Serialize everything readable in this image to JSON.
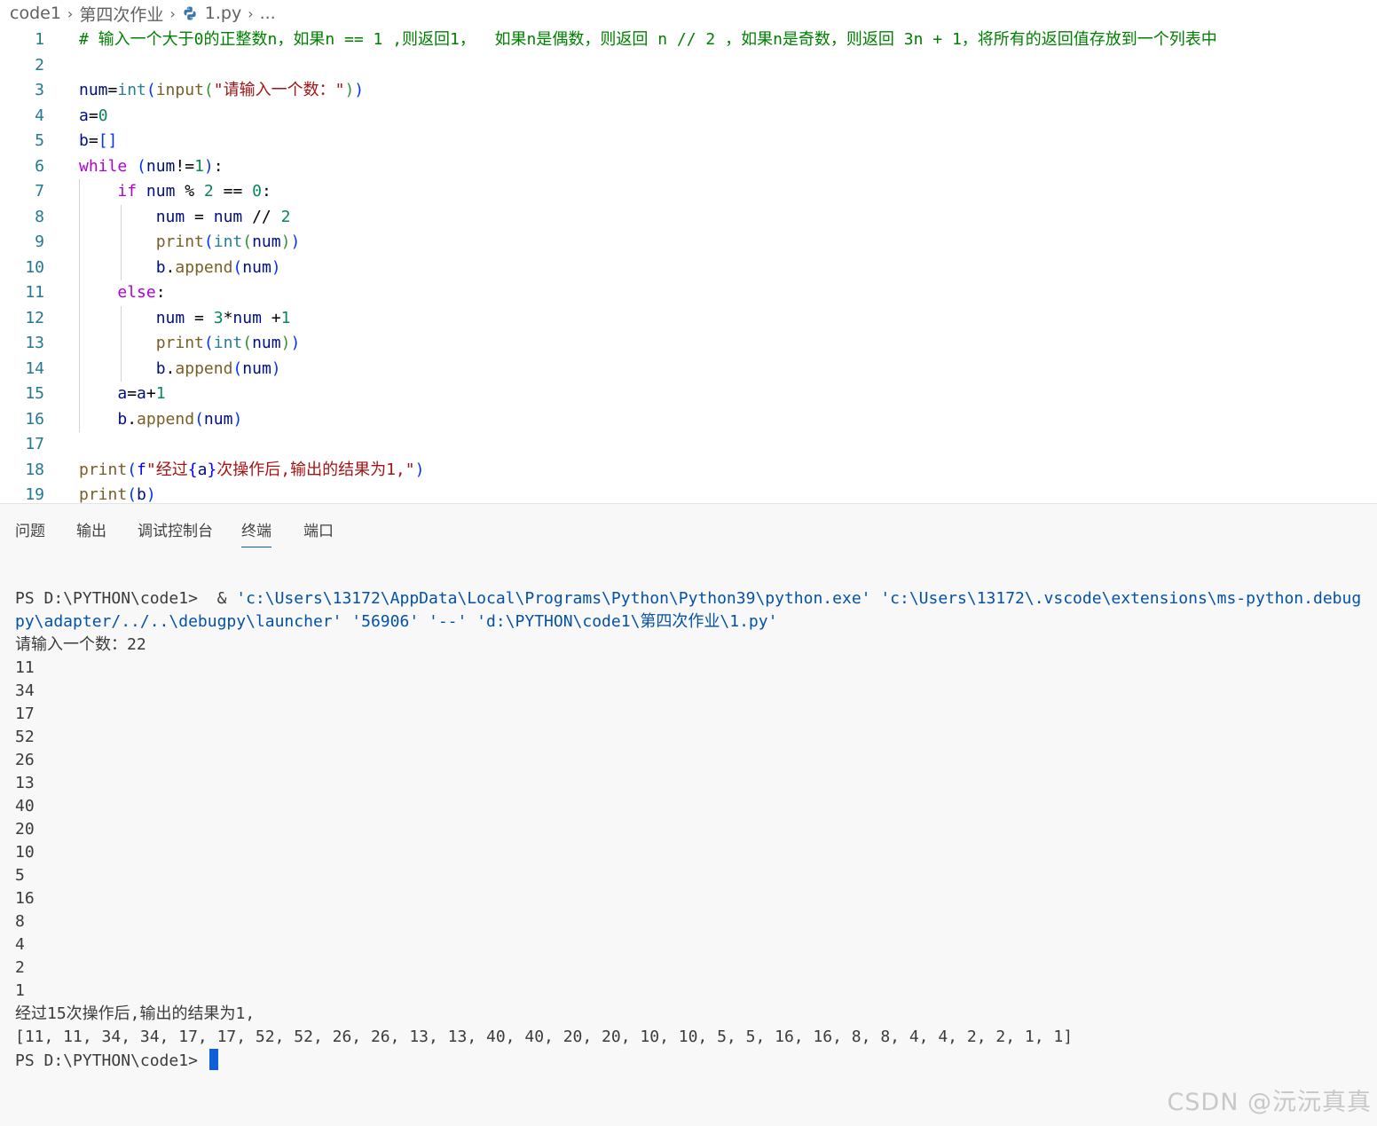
{
  "breadcrumb": {
    "items": [
      "code1",
      "第四次作业",
      "1.py",
      "..."
    ]
  },
  "editor": {
    "line_numbers": [
      "1",
      "2",
      "3",
      "4",
      "5",
      "6",
      "7",
      "8",
      "9",
      "10",
      "11",
      "12",
      "13",
      "14",
      "15",
      "16",
      "17",
      "18",
      "19"
    ],
    "lines": [
      [
        {
          "t": "# 输入一个大于0的正整数n，如果n == 1 ,则返回1，  如果n是偶数，则返回 n // 2 ，如果n是奇数，则返回 3n + 1，将所有的返回值存放到一个列表中",
          "c": "c-com"
        }
      ],
      [],
      [
        {
          "t": "num",
          "c": "c-var"
        },
        {
          "t": "=",
          "c": "c-op"
        },
        {
          "t": "int",
          "c": "c-bi"
        },
        {
          "t": "(",
          "c": "c-br1"
        },
        {
          "t": "input",
          "c": "c-fn"
        },
        {
          "t": "(",
          "c": "c-br2"
        },
        {
          "t": "\"请输入一个数：\"",
          "c": "c-str"
        },
        {
          "t": ")",
          "c": "c-br2"
        },
        {
          "t": ")",
          "c": "c-br1"
        }
      ],
      [
        {
          "t": "a",
          "c": "c-var"
        },
        {
          "t": "=",
          "c": "c-op"
        },
        {
          "t": "0",
          "c": "c-num"
        }
      ],
      [
        {
          "t": "b",
          "c": "c-var"
        },
        {
          "t": "=",
          "c": "c-op"
        },
        {
          "t": "[]",
          "c": "c-br1"
        }
      ],
      [
        {
          "t": "while",
          "c": "c-kw"
        },
        {
          "t": " ",
          "c": "c-op"
        },
        {
          "t": "(",
          "c": "c-br1"
        },
        {
          "t": "num",
          "c": "c-var"
        },
        {
          "t": "!=",
          "c": "c-op"
        },
        {
          "t": "1",
          "c": "c-num"
        },
        {
          "t": ")",
          "c": "c-br1"
        },
        {
          "t": ":",
          "c": "c-op"
        }
      ],
      [
        {
          "t": "    ",
          "c": "c-op"
        },
        {
          "t": "if",
          "c": "c-kw"
        },
        {
          "t": " ",
          "c": "c-op"
        },
        {
          "t": "num",
          "c": "c-var"
        },
        {
          "t": " % ",
          "c": "c-op"
        },
        {
          "t": "2",
          "c": "c-num"
        },
        {
          "t": " == ",
          "c": "c-op"
        },
        {
          "t": "0",
          "c": "c-num"
        },
        {
          "t": ":",
          "c": "c-op"
        }
      ],
      [
        {
          "t": "        ",
          "c": "c-op"
        },
        {
          "t": "num",
          "c": "c-var"
        },
        {
          "t": " = ",
          "c": "c-op"
        },
        {
          "t": "num",
          "c": "c-var"
        },
        {
          "t": " // ",
          "c": "c-op"
        },
        {
          "t": "2",
          "c": "c-num"
        }
      ],
      [
        {
          "t": "        ",
          "c": "c-op"
        },
        {
          "t": "print",
          "c": "c-fn"
        },
        {
          "t": "(",
          "c": "c-br1"
        },
        {
          "t": "int",
          "c": "c-bi"
        },
        {
          "t": "(",
          "c": "c-br2"
        },
        {
          "t": "num",
          "c": "c-var"
        },
        {
          "t": ")",
          "c": "c-br2"
        },
        {
          "t": ")",
          "c": "c-br1"
        }
      ],
      [
        {
          "t": "        ",
          "c": "c-op"
        },
        {
          "t": "b",
          "c": "c-var"
        },
        {
          "t": ".",
          "c": "c-op"
        },
        {
          "t": "append",
          "c": "c-fn"
        },
        {
          "t": "(",
          "c": "c-br1"
        },
        {
          "t": "num",
          "c": "c-var"
        },
        {
          "t": ")",
          "c": "c-br1"
        }
      ],
      [
        {
          "t": "    ",
          "c": "c-op"
        },
        {
          "t": "else",
          "c": "c-kw"
        },
        {
          "t": ":",
          "c": "c-op"
        }
      ],
      [
        {
          "t": "        ",
          "c": "c-op"
        },
        {
          "t": "num",
          "c": "c-var"
        },
        {
          "t": " = ",
          "c": "c-op"
        },
        {
          "t": "3",
          "c": "c-num"
        },
        {
          "t": "*",
          "c": "c-op"
        },
        {
          "t": "num",
          "c": "c-var"
        },
        {
          "t": " +",
          "c": "c-op"
        },
        {
          "t": "1",
          "c": "c-num"
        }
      ],
      [
        {
          "t": "        ",
          "c": "c-op"
        },
        {
          "t": "print",
          "c": "c-fn"
        },
        {
          "t": "(",
          "c": "c-br1"
        },
        {
          "t": "int",
          "c": "c-bi"
        },
        {
          "t": "(",
          "c": "c-br2"
        },
        {
          "t": "num",
          "c": "c-var"
        },
        {
          "t": ")",
          "c": "c-br2"
        },
        {
          "t": ")",
          "c": "c-br1"
        }
      ],
      [
        {
          "t": "        ",
          "c": "c-op"
        },
        {
          "t": "b",
          "c": "c-var"
        },
        {
          "t": ".",
          "c": "c-op"
        },
        {
          "t": "append",
          "c": "c-fn"
        },
        {
          "t": "(",
          "c": "c-br1"
        },
        {
          "t": "num",
          "c": "c-var"
        },
        {
          "t": ")",
          "c": "c-br1"
        }
      ],
      [
        {
          "t": "    ",
          "c": "c-op"
        },
        {
          "t": "a",
          "c": "c-var"
        },
        {
          "t": "=",
          "c": "c-op"
        },
        {
          "t": "a",
          "c": "c-var"
        },
        {
          "t": "+",
          "c": "c-op"
        },
        {
          "t": "1",
          "c": "c-num"
        }
      ],
      [
        {
          "t": "    ",
          "c": "c-op"
        },
        {
          "t": "b",
          "c": "c-var"
        },
        {
          "t": ".",
          "c": "c-op"
        },
        {
          "t": "append",
          "c": "c-fn"
        },
        {
          "t": "(",
          "c": "c-br1"
        },
        {
          "t": "num",
          "c": "c-var"
        },
        {
          "t": ")",
          "c": "c-br1"
        }
      ],
      [],
      [
        {
          "t": "print",
          "c": "c-fn"
        },
        {
          "t": "(",
          "c": "c-br1"
        },
        {
          "t": "f",
          "c": "c-fpre"
        },
        {
          "t": "\"经过",
          "c": "c-str"
        },
        {
          "t": "{",
          "c": "c-fpre"
        },
        {
          "t": "a",
          "c": "c-var"
        },
        {
          "t": "}",
          "c": "c-fpre"
        },
        {
          "t": "次操作后,输出的结果为1,\"",
          "c": "c-str"
        },
        {
          "t": ")",
          "c": "c-br1"
        }
      ],
      [
        {
          "t": "print",
          "c": "c-fn"
        },
        {
          "t": "(",
          "c": "c-br1"
        },
        {
          "t": "b",
          "c": "c-var"
        },
        {
          "t": ")",
          "c": "c-br1"
        }
      ]
    ]
  },
  "panel": {
    "tabs": [
      "问题",
      "输出",
      "调试控制台",
      "终端",
      "端口"
    ],
    "active_tab": "终端"
  },
  "terminal": {
    "cmd_prompt": "PS D:\\PYTHON\\code1>  & ",
    "cmd_part1": "'c:\\Users\\13172\\AppData\\Local\\Programs\\Python\\Python39\\python.exe' 'c:\\Users\\13172\\.vscode\\extensions\\ms-python.debug",
    "cmd_part2": "py\\adapter/../..\\debugpy\\launcher' '56906' '--' 'd:\\PYTHON\\code1\\第四次作业\\1.py'",
    "input_line": "请输入一个数：22",
    "outputs": [
      "11",
      "34",
      "17",
      "52",
      "26",
      "13",
      "40",
      "20",
      "10",
      "5",
      "16",
      "8",
      "4",
      "2",
      "1"
    ],
    "summary": "经过15次操作后,输出的结果为1,",
    "list_line": "[11, 11, 34, 34, 17, 17, 52, 52, 26, 26, 13, 13, 40, 40, 20, 20, 10, 10, 5, 5, 16, 16, 8, 8, 4, 4, 2, 2, 1, 1]",
    "final_prompt": "PS D:\\PYTHON\\code1> "
  },
  "watermark": "CSDN @沅沅真真",
  "colors": {
    "line_number": "#237893",
    "keyword": "#af00db",
    "comment": "#008000",
    "string": "#a31515",
    "cursor": "#0e5fd8"
  }
}
